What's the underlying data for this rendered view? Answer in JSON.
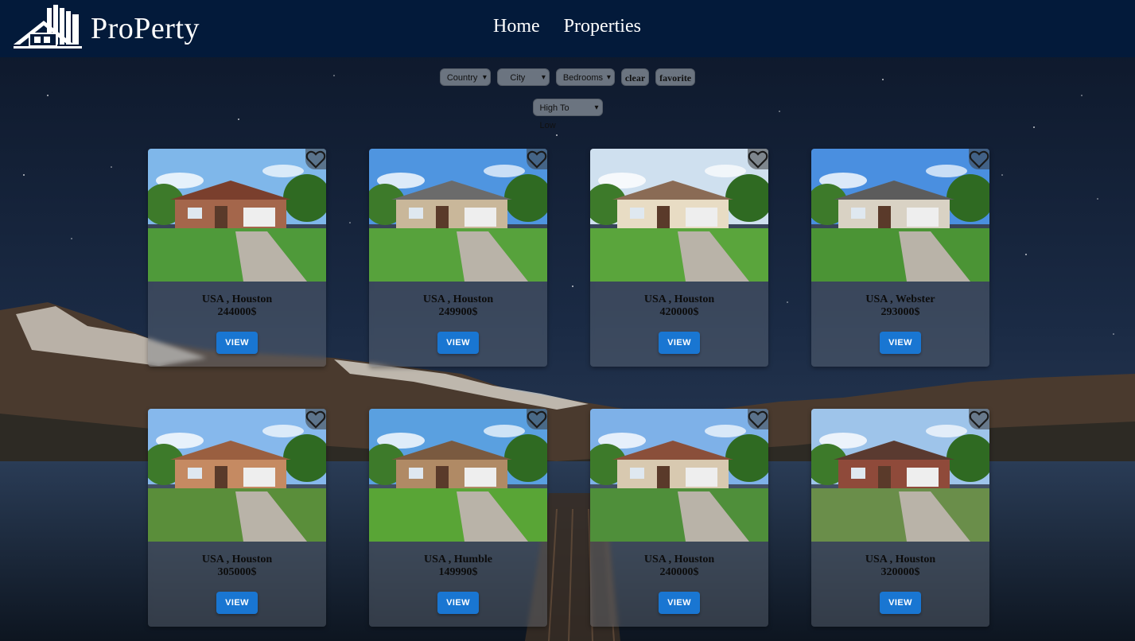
{
  "header": {
    "brand": "ProPerty",
    "nav": [
      "Home",
      "Properties"
    ]
  },
  "filters": {
    "country": "Country",
    "city": "City",
    "bedrooms": "Bedrooms",
    "clear": "clear",
    "favorite": "favorite",
    "sort": "High To Low"
  },
  "listings": [
    {
      "location": "USA , Houston",
      "price": "244000$",
      "view": "VIEW",
      "sky": "#7fb7ea",
      "house": "#a4664b",
      "roof": "#7a3f2d",
      "lawn": "#4f9a3a"
    },
    {
      "location": "USA , Houston",
      "price": "249900$",
      "view": "VIEW",
      "sky": "#4f95e0",
      "house": "#c9b79a",
      "roof": "#6b6b6b",
      "lawn": "#57a23c"
    },
    {
      "location": "USA , Houston",
      "price": "420000$",
      "view": "VIEW",
      "sky": "#cfe0ef",
      "house": "#e8dcc4",
      "roof": "#8a6b55",
      "lawn": "#5aa53c"
    },
    {
      "location": "USA , Webster",
      "price": "293000$",
      "view": "VIEW",
      "sky": "#4a8fe0",
      "house": "#d9d2c4",
      "roof": "#5c5c5c",
      "lawn": "#4b9435"
    },
    {
      "location": "USA , Houston",
      "price": "305000$",
      "view": "VIEW",
      "sky": "#86b8ec",
      "house": "#c58a62",
      "roof": "#9a5f40",
      "lawn": "#5a8e3a"
    },
    {
      "location": "USA , Humble",
      "price": "149990$",
      "view": "VIEW",
      "sky": "#5aa0e0",
      "house": "#b08a65",
      "roof": "#7a5a40",
      "lawn": "#59a536"
    },
    {
      "location": "USA , Houston",
      "price": "240000$",
      "view": "VIEW",
      "sky": "#7eb1e8",
      "house": "#d8c9b0",
      "roof": "#8a4f3a",
      "lawn": "#4f8f3a"
    },
    {
      "location": "USA , Houston",
      "price": "320000$",
      "view": "VIEW",
      "sky": "#9ec4ea",
      "house": "#8f4a3a",
      "roof": "#5a3a30",
      "lawn": "#6a8e4a"
    }
  ]
}
